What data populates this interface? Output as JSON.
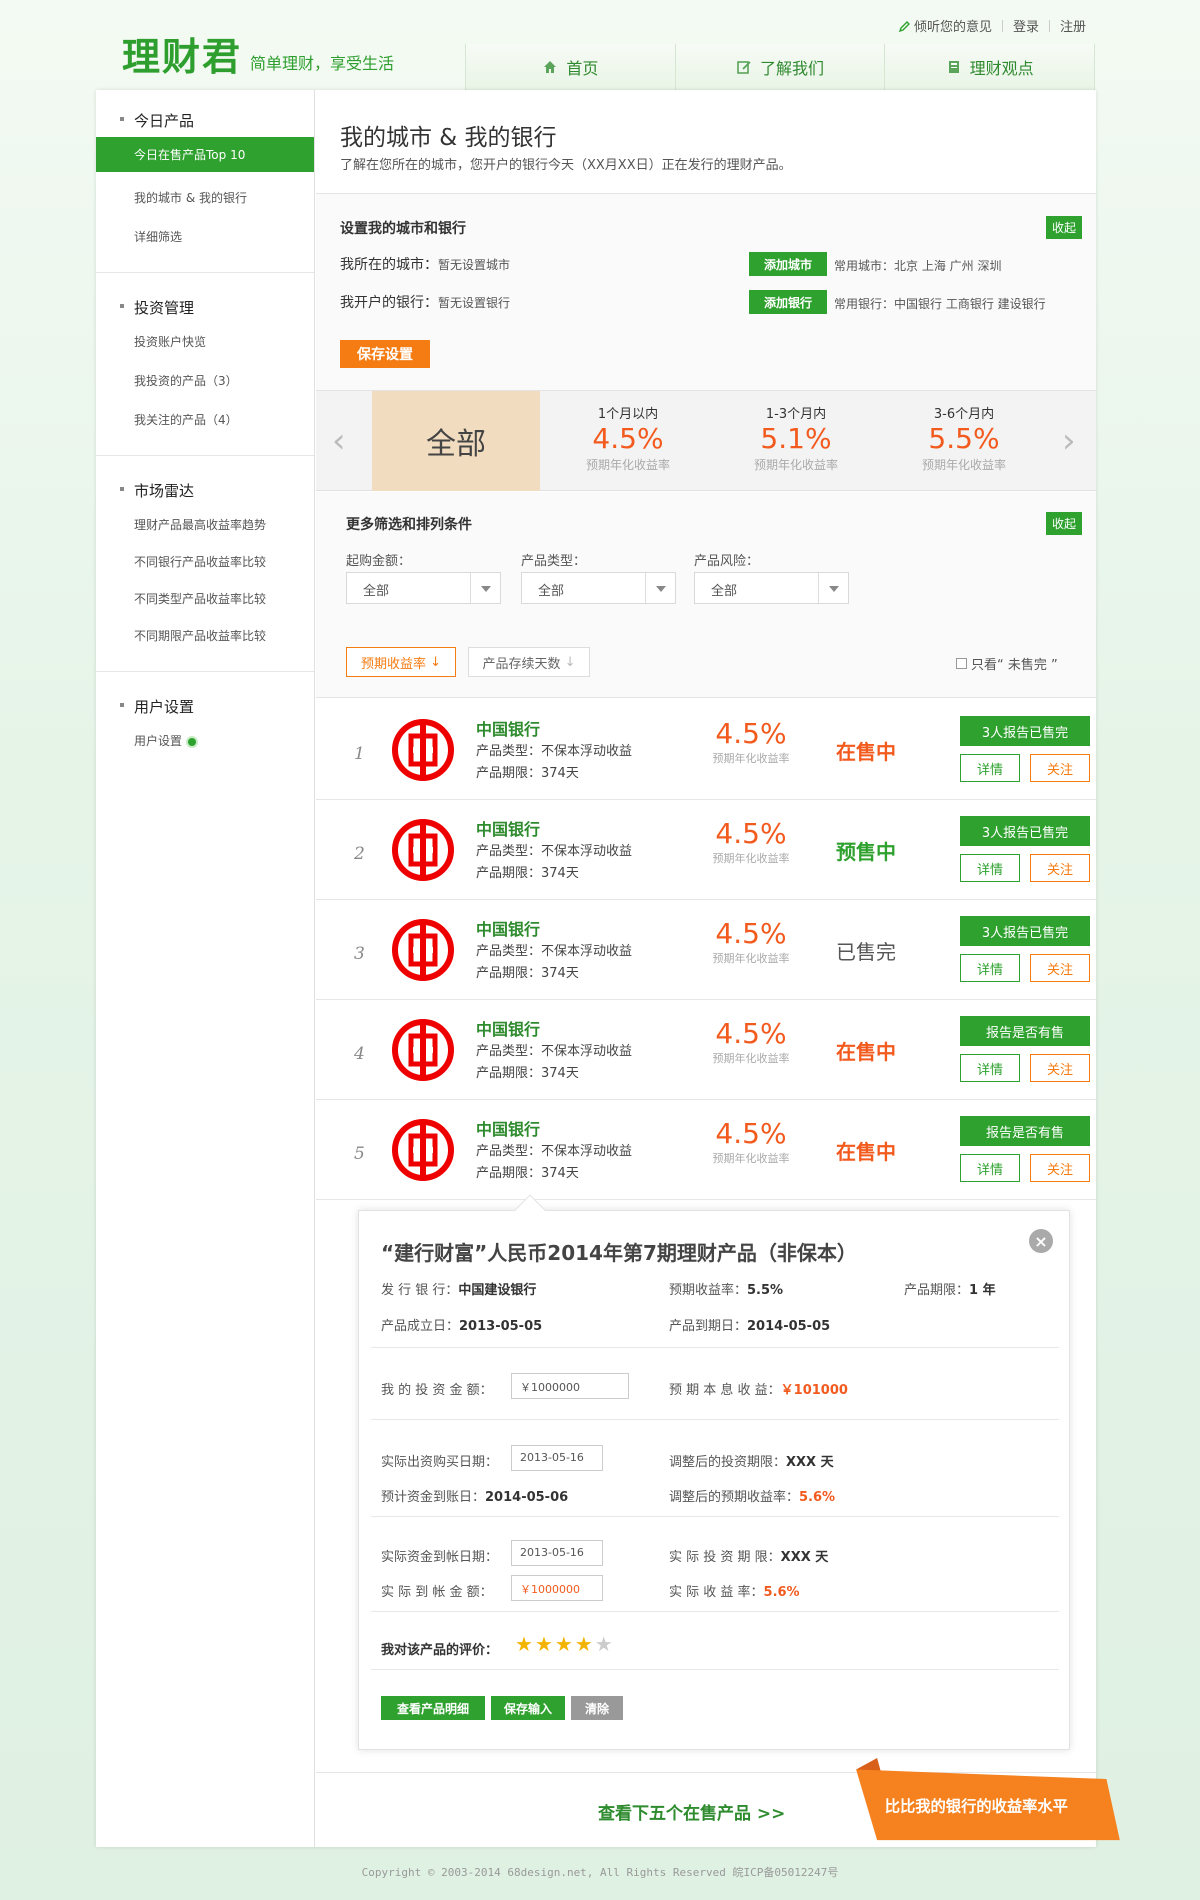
{
  "brand": {
    "logo": "理财君",
    "slogan": "简单理财，享受生活"
  },
  "toplinks": {
    "feedback": "倾听您的意见",
    "login": "登录",
    "register": "注册"
  },
  "nav": [
    {
      "label": "首页"
    },
    {
      "label": "了解我们"
    },
    {
      "label": "理财观点"
    }
  ],
  "sidebar": {
    "groups": [
      {
        "title": "今日产品",
        "items": [
          "今日在售产品Top 10",
          "我的城市 & 我的银行",
          "详细筛选"
        ]
      },
      {
        "title": "投资管理",
        "items": [
          "投资账户快览",
          "我投资的产品（3）",
          "我关注的产品（4）"
        ]
      },
      {
        "title": "市场雷达",
        "items": [
          "理财产品最高收益率趋势",
          "不同银行产品收益率比较",
          "不同类型产品收益率比较",
          "不同期限产品收益率比较"
        ]
      },
      {
        "title": "用户设置",
        "items": [
          "用户设置"
        ]
      }
    ]
  },
  "page": {
    "title": "我的城市 & 我的银行",
    "subtitle": "了解在您所在的城市，您开户的银行今天（XX月XX日）正在发行的理财产品。"
  },
  "settings": {
    "title": "设置我的城市和银行",
    "collapse": "收起",
    "city_label": "我所在的城市：",
    "city_value": "暂无设置城市",
    "bank_label": "我开户的银行：",
    "bank_value": "暂无设置银行",
    "add_city": "添加城市",
    "add_bank": "添加银行",
    "common_cities": "常用城市：北京   上海   广州   深圳",
    "common_banks": "常用银行：中国银行   工商银行   建设银行",
    "save": "保存设置"
  },
  "period_tabs": {
    "all": "全部",
    "items": [
      {
        "title": "1个月以内",
        "rate": "4.5%",
        "label": "预期年化收益率"
      },
      {
        "title": "1-3个月内",
        "rate": "5.1%",
        "label": "预期年化收益率"
      },
      {
        "title": "3-6个月内",
        "rate": "5.5%",
        "label": "预期年化收益率"
      }
    ]
  },
  "filters": {
    "title": "更多筛选和排列条件",
    "collapse": "收起",
    "amount_label": "起购金额：",
    "amount_value": "全部",
    "type_label": "产品类型：",
    "type_value": "全部",
    "risk_label": "产品风险：",
    "risk_value": "全部",
    "sort_rate": "预期收益率",
    "sort_days": "产品存续天数",
    "only_unsold": "只看“ 未售完 ”"
  },
  "products": [
    {
      "num": "1",
      "bank": "中国银行",
      "type": "产品类型：不保本浮动收益",
      "term": "产品期限：374天",
      "rate": "4.5%",
      "rate_label": "预期年化收益率",
      "status": "在售中",
      "status_kind": "on",
      "report": "3人报告已售完",
      "detail": "详情",
      "follow": "关注"
    },
    {
      "num": "2",
      "bank": "中国银行",
      "type": "产品类型：不保本浮动收益",
      "term": "产品期限：374天",
      "rate": "4.5%",
      "rate_label": "预期年化收益率",
      "status": "预售中",
      "status_kind": "pre",
      "report": "3人报告已售完",
      "detail": "详情",
      "follow": "关注"
    },
    {
      "num": "3",
      "bank": "中国银行",
      "type": "产品类型：不保本浮动收益",
      "term": "产品期限：374天",
      "rate": "4.5%",
      "rate_label": "预期年化收益率",
      "status": "已售完",
      "status_kind": "done",
      "report": "3人报告已售完",
      "detail": "详情",
      "follow": "关注"
    },
    {
      "num": "4",
      "bank": "中国银行",
      "type": "产品类型：不保本浮动收益",
      "term": "产品期限：374天",
      "rate": "4.5%",
      "rate_label": "预期年化收益率",
      "status": "在售中",
      "status_kind": "on",
      "report": "报告是否有售",
      "detail": "详情",
      "follow": "关注"
    },
    {
      "num": "5",
      "bank": "中国银行",
      "type": "产品类型：不保本浮动收益",
      "term": "产品期限：374天",
      "rate": "4.5%",
      "rate_label": "预期年化收益率",
      "status": "在售中",
      "status_kind": "on",
      "report": "报告是否有售",
      "detail": "详情",
      "follow": "关注"
    }
  ],
  "popup": {
    "title": "“建行财富”人民币2014年第7期理财产品（非保本）",
    "issuer_label": "发 行 银 行：",
    "issuer": "中国建设银行",
    "exp_rate_label": "预期收益率：",
    "exp_rate": "5.5%",
    "term_label": "产品期限：",
    "term": "1 年",
    "found_label": "产品成立日：",
    "found": "2013-05-05",
    "due_label": "产品到期日：",
    "due": "2014-05-05",
    "invest_label": "我 的 投 资 金 额：",
    "invest_value": "￥1000000",
    "exp_income_label": "预 期 本 息 收 益：",
    "exp_income": "￥101000",
    "buy_date_label": "实际出资购买日期：",
    "buy_date": "2013-05-16",
    "adj_days_label": "调整后的投资期限：",
    "adj_days": "XXX 天",
    "arrive_label": "预计资金到账日：",
    "arrive": "2014-05-06",
    "adj_rate_label": "调整后的预期收益率：",
    "adj_rate": "5.6%",
    "real_arrive_label": "实际资金到帐日期：",
    "real_arrive": "2013-05-16",
    "real_days_label": "实 际 投 资 期 限：",
    "real_days": "XXX 天",
    "real_amount_label": "实 际 到 帐 金 额：",
    "real_amount": "￥1000000",
    "real_rate_label": "实  际  收  益  率：",
    "real_rate": "5.6%",
    "review_label": "我对该产品的评价：",
    "rating": 4,
    "btn_detail": "查看产品明细",
    "btn_save": "保存输入",
    "btn_clear": "清除"
  },
  "next_five": "查看下五个在售产品  >>",
  "compare_banner": "比比我的银行的收益率水平",
  "footer": "Copyright © 2003-2014 68design.net, All Rights Reserved  皖ICP备05012247号",
  "colors": {
    "brand_green": "#2fa12f",
    "accent_orange": "#f57c13",
    "rate_red": "#f25a1e"
  }
}
